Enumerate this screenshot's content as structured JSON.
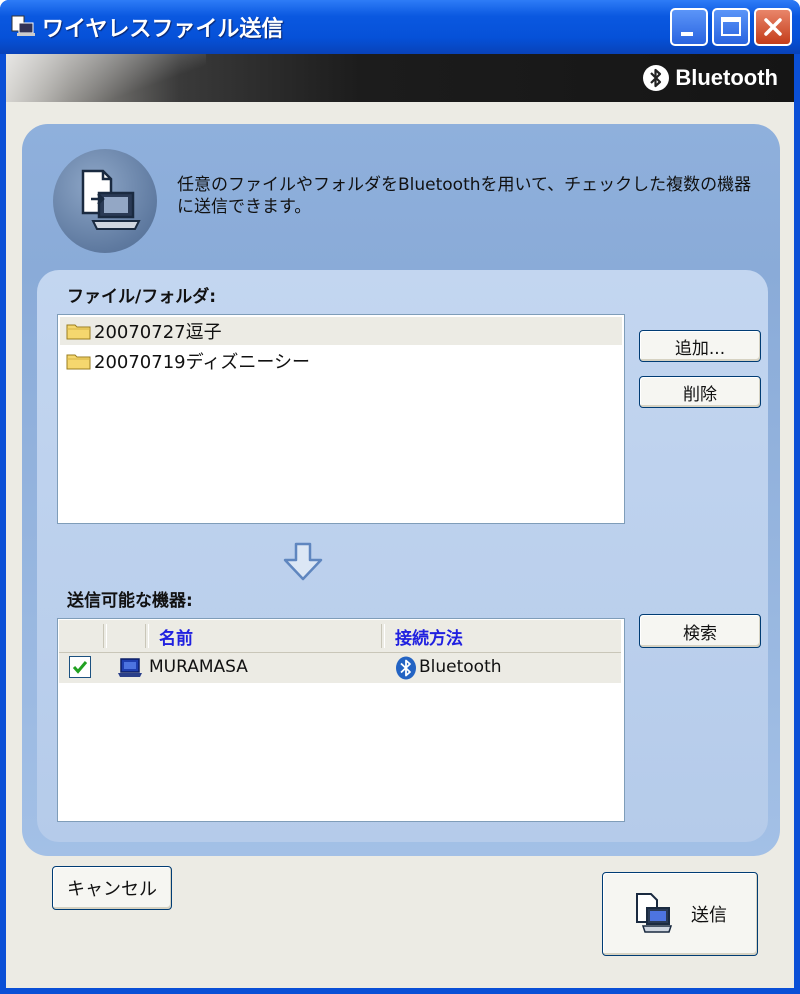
{
  "window": {
    "title": "ワイヤレスファイル送信",
    "brand": "Bluetooth"
  },
  "intro": {
    "description": "任意のファイルやフォルダをBluetoothを用いて、チェックした複数の機器に送信できます。"
  },
  "files": {
    "label": "ファイル/フォルダ:",
    "items": [
      "20070727逗子",
      "20070719ディズニーシー"
    ],
    "add_label": "追加...",
    "delete_label": "削除"
  },
  "devices": {
    "label": "送信可能な機器:",
    "columns": [
      "名前",
      "接続方法"
    ],
    "rows": [
      {
        "checked": true,
        "name": "MURAMASA",
        "method": "Bluetooth"
      }
    ],
    "search_label": "検索"
  },
  "footer": {
    "cancel_label": "キャンセル",
    "send_label": "送信"
  },
  "colors": {
    "titlebar": "#0a58e0",
    "panel": "#8fb0dc",
    "header_text": "#2020e0"
  }
}
